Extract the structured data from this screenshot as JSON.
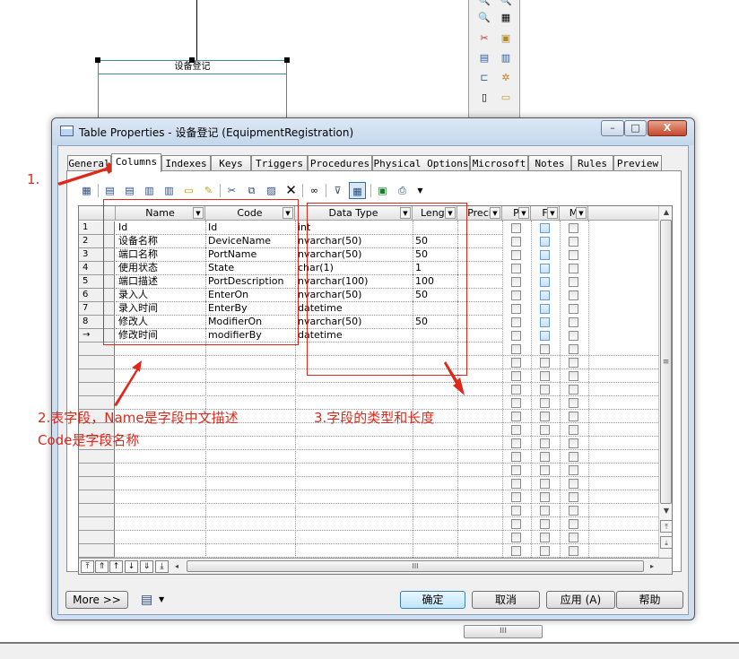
{
  "entity": {
    "title": "设备登记"
  },
  "window": {
    "title": "Table Properties - 设备登记 (EquipmentRegistration)",
    "controls": {
      "minimize": "–",
      "maximize": "□",
      "close": "X"
    }
  },
  "tabs": [
    "General",
    "Columns",
    "Indexes",
    "Keys",
    "Triggers",
    "Procedures",
    "Physical Options",
    "Microsoft",
    "Notes",
    "Rules",
    "Preview"
  ],
  "active_tab": "Columns",
  "grid": {
    "headers": [
      "Name",
      "Code",
      "Data Type",
      "Lengt",
      "Preci",
      "P",
      "F",
      "M"
    ],
    "rows": [
      {
        "num": "1",
        "name": "Id",
        "code": "Id",
        "type": "int",
        "length": ""
      },
      {
        "num": "2",
        "name": "设备名称",
        "code": "DeviceName",
        "type": "nvarchar(50)",
        "length": "50"
      },
      {
        "num": "3",
        "name": "端口名称",
        "code": "PortName",
        "type": "nvarchar(50)",
        "length": "50"
      },
      {
        "num": "4",
        "name": "使用状态",
        "code": "State",
        "type": "char(1)",
        "length": "1"
      },
      {
        "num": "5",
        "name": "端口描述",
        "code": "PortDescription",
        "type": "nvarchar(100)",
        "length": "100"
      },
      {
        "num": "6",
        "name": "录入人",
        "code": "EnterOn",
        "type": "nvarchar(50)",
        "length": "50"
      },
      {
        "num": "7",
        "name": "录入时间",
        "code": "EnterBy",
        "type": "datetime",
        "length": ""
      },
      {
        "num": "8",
        "name": "修改人",
        "code": "ModifierOn",
        "type": "nvarchar(50)",
        "length": "50"
      },
      {
        "num": "→",
        "name": "修改时间",
        "code": "modifierBy",
        "type": "datetime",
        "length": ""
      }
    ],
    "scroll_marks": {
      "v": "≡",
      "h": "III"
    }
  },
  "buttons": {
    "more": "More >>",
    "ok": "确定",
    "cancel": "取消",
    "apply": "应用 (A)",
    "help": "帮助"
  },
  "annotations": {
    "a1": "1.",
    "a2_line1": "2.表字段，Name是字段中文描述",
    "a2_line2": "Code是字段名称",
    "a3": "3.字段的类型和长度"
  },
  "colors": {
    "annotation": "#e0281a",
    "titlebar": "#c4d7ec",
    "default_button": "#bee6fd"
  }
}
